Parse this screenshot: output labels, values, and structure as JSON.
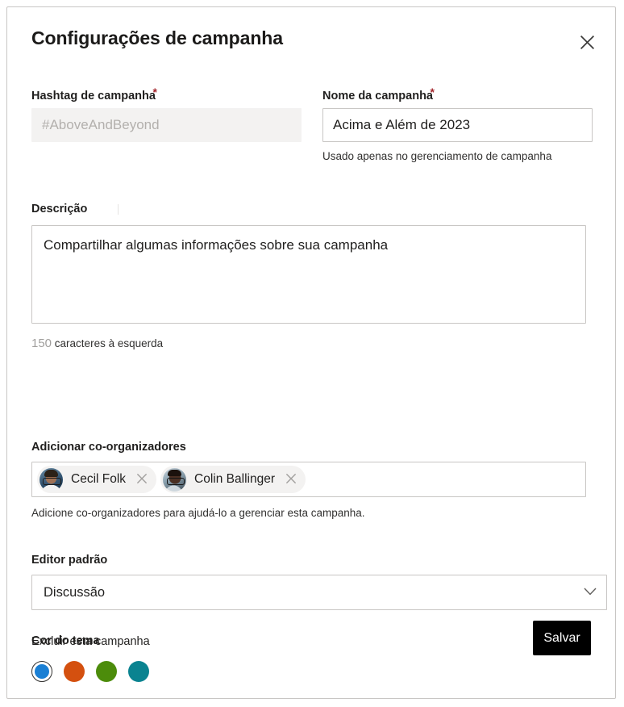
{
  "dialog": {
    "title": "Configurações de campanha",
    "close_icon": "close-icon"
  },
  "fields": {
    "hashtag": {
      "label": "Hashtag de campanha",
      "required_mark": "*",
      "value": "",
      "placeholder": "#AboveAndBeyond",
      "disabled": true
    },
    "campaign_name": {
      "label": "Nome da campanha",
      "required_mark": "*",
      "value": "Acima e Além de 2023",
      "placeholder": "",
      "note": "Usado apenas no gerenciamento de campanha"
    },
    "description": {
      "label": "Descrição",
      "value": "Compartilhar algumas informações sobre sua campanha",
      "placeholder": "",
      "chars_left_count": "150",
      "chars_left_text": "caracteres à esquerda"
    },
    "coorganizers": {
      "label": "Adicionar co-organizadores",
      "note": "Adicione co-organizadores para ajudá-lo a gerenciar esta campanha.",
      "remove_icon": "close-icon",
      "people": [
        {
          "name": "Cecil  Folk",
          "avatar": "avatar-cecil-folk"
        },
        {
          "name": "Colin Ballinger",
          "avatar": "avatar-colin-ballinger"
        }
      ]
    },
    "default_editor": {
      "label": "Editor padrão",
      "value": "Discussão",
      "chevron_icon": "chevron-down-icon"
    },
    "theme_color": {
      "label": "Cor do tema",
      "selected_index": 0,
      "swatches": [
        {
          "name": "blue",
          "hex": "#1a7fd4"
        },
        {
          "name": "orange",
          "hex": "#d4500f"
        },
        {
          "name": "green",
          "hex": "#4c8c0b"
        },
        {
          "name": "teal",
          "hex": "#0a8390"
        }
      ]
    }
  },
  "footer": {
    "delete_label": "Excluir esta campanha",
    "save_label": "Salvar"
  }
}
